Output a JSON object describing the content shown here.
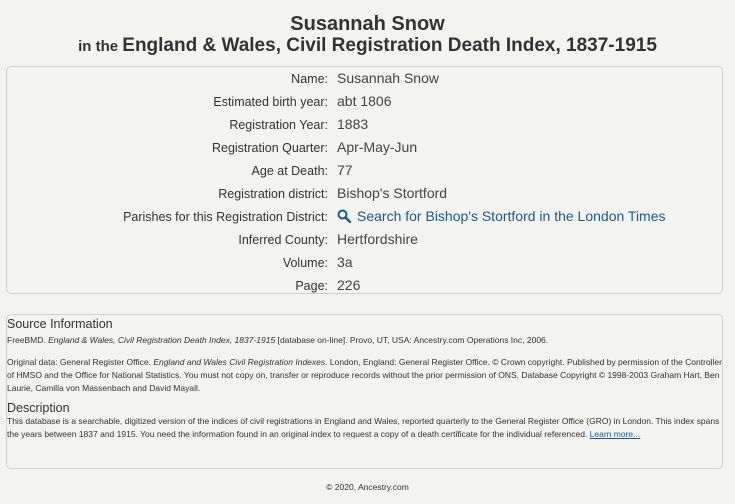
{
  "header": {
    "name": "Susannah Snow",
    "prefix": "in the ",
    "database": "England & Wales, Civil Registration Death Index, 1837-1915"
  },
  "details": [
    {
      "label": "Name:",
      "value": "Susannah Snow"
    },
    {
      "label": "Estimated birth year:",
      "value": "abt 1806"
    },
    {
      "label": "Registration Year:",
      "value": "1883"
    },
    {
      "label": "Registration Quarter:",
      "value": "Apr-May-Jun"
    },
    {
      "label": "Age at Death:",
      "value": "77"
    },
    {
      "label": "Registration district:",
      "value": "Bishop's Stortford"
    },
    {
      "label": "Parishes for this Registration District:",
      "value": "Search for Bishop's Stortford in the London Times",
      "icon": "search-icon"
    },
    {
      "label": "Inferred County:",
      "value": "Hertfordshire"
    },
    {
      "label": "Volume:",
      "value": "3a"
    },
    {
      "label": "Page:",
      "value": "226"
    }
  ],
  "source": {
    "heading": "Source Information",
    "citation_prefix": "FreeBMD. ",
    "citation_title": "England & Wales, Civil Registration Death Index, 1837-1915",
    "citation_suffix": " [database on-line]. Provo, UT, USA: Ancestry.com Operations Inc, 2006.",
    "original_prefix": "Original data: General Register Office. ",
    "original_title": "England and Wales Civil Registration Indexes",
    "original_suffix": ". London, England: General Register Office. © Crown copyright. Published by permission of the Controller of HMSO and the Office for National Statistics. You must not copy on, transfer or reproduce records without the prior permission of ONS. Database Copyright © 1998-2003 Graham Hart, Ben Laurie, Camilla von Massenbach and David Mayall."
  },
  "description": {
    "heading": "Description",
    "text": "This database is a searchable, digitized version of the indices of civil registrations in England and Wales, reported quarterly to the General Register Office (GRO) in London. This index spans the years between 1837 and 1915. You need the information found in an original index to request a copy of a death certificate for the individual referenced. ",
    "learn_more": "Learn more..."
  },
  "footer": {
    "copyright": "© 2020, Ancestry.com"
  },
  "colors": {
    "background": "#f3f3f2",
    "link": "#1c5a8a",
    "border": "#cfcfcf"
  }
}
